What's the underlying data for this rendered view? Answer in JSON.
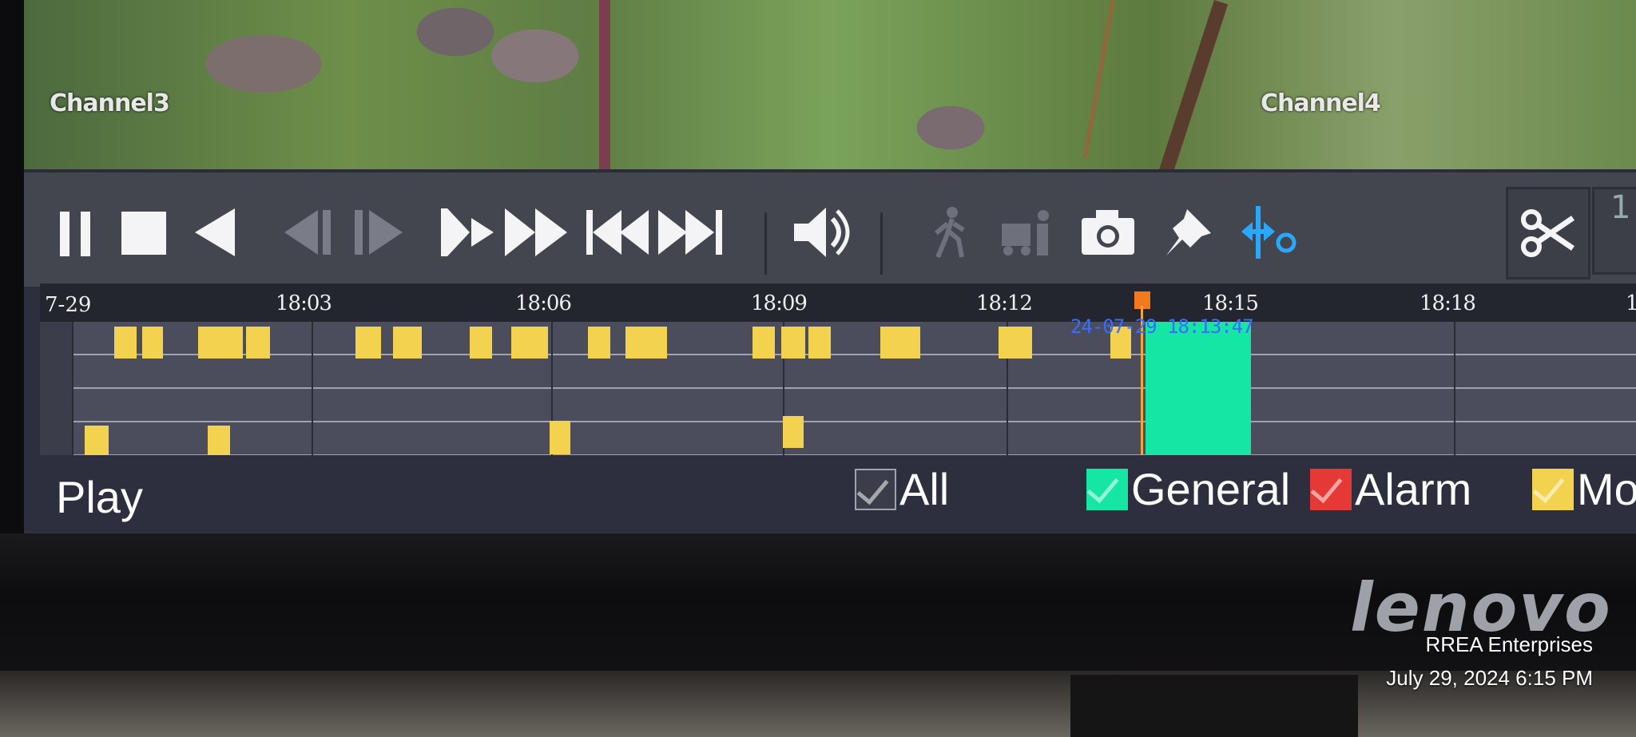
{
  "video": {
    "channel_left": "Channel3",
    "channel_right": "Channel4"
  },
  "toolbar": {
    "buttons": [
      "pause-icon",
      "stop-icon",
      "reverse-play-icon",
      "frame-back-icon",
      "frame-forward-icon",
      "slow-play-icon",
      "fast-forward-icon",
      "skip-previous-icon",
      "skip-next-icon",
      "volume-icon",
      "person-icon",
      "vehicle-person-icon",
      "camera-icon",
      "pin-icon",
      "zoom-fit-icon",
      "scissors-icon"
    ],
    "next_box_text": "1"
  },
  "timeline": {
    "date": "7-29",
    "ticks": [
      "18:03",
      "18:06",
      "18:09",
      "18:12",
      "18:15",
      "18:18",
      "1"
    ],
    "cursor_time": "24-07-29 18:13:47",
    "colors": {
      "motion": "#f2d24e",
      "general": "#16e6a4",
      "alarm": "#e53935",
      "cursor": "#f37a1c"
    }
  },
  "legend": {
    "mode_label": "Play",
    "all_label": "All",
    "general_label": "General",
    "alarm_label": "Alarm",
    "motion_label": "Mot"
  },
  "monitor": {
    "brand": "lenovo"
  },
  "photo_stamp": {
    "owner": "RREA Enterprises",
    "datetime": "July 29, 2024 6:15 PM"
  }
}
